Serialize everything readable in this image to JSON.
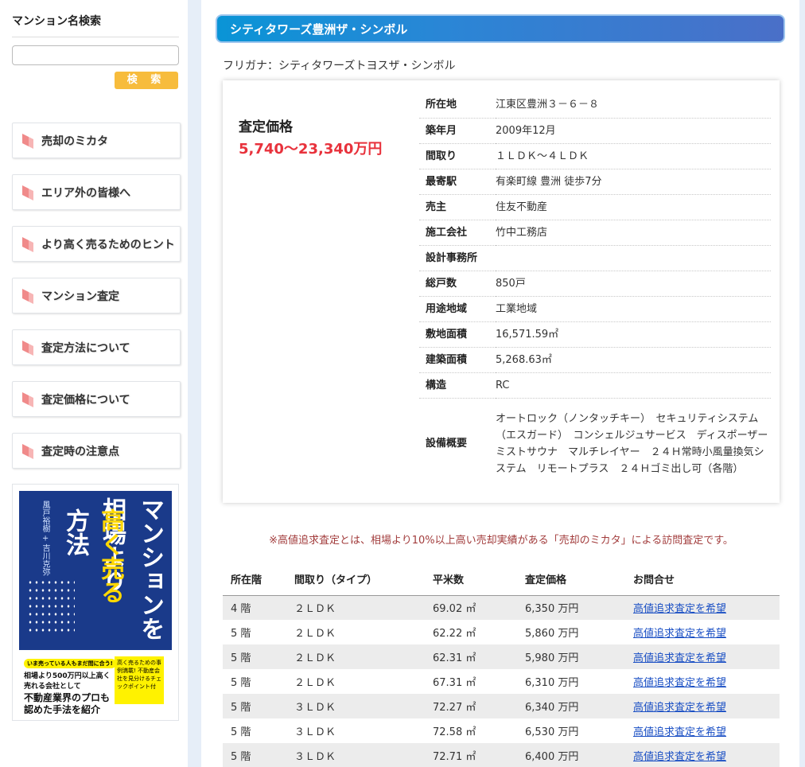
{
  "sidebar": {
    "search_title": "マンション名検索",
    "search_input_value": "",
    "search_button": "検 索",
    "menu": [
      {
        "label": "売却のミカタ"
      },
      {
        "label": "エリア外の皆様へ"
      },
      {
        "label": "より高く売るためのヒント"
      },
      {
        "label": "マンション査定"
      },
      {
        "label": "査定方法について"
      },
      {
        "label": "査定価格について"
      },
      {
        "label": "査定時の注意点"
      }
    ],
    "icon_color": "#f08a8a",
    "book": {
      "title_line1": "マンションを",
      "title_line2": "相場より",
      "title_line3": "高く売る",
      "title_line4": "方法",
      "authors": "風戸裕樹 + 吉川克弥",
      "badge": "いま売っている人もまだ間に合う!",
      "sub1": "相場より500万円以上高く売れる会社として",
      "sub2": "不動産業界のプロも認めた手法を紹介",
      "yellow_box": "高く売るための事例満載! 不動産会社を見分けるチェックポイント付"
    }
  },
  "main": {
    "title": "シティタワーズ豊洲ザ・シンボル",
    "furigana": "フリガナ：シティタワーズトヨスザ・シンボル",
    "price_label": "査定価格",
    "price_value": "5,740～23,340万円",
    "specs": [
      {
        "key": "所在地",
        "value": "江東区豊洲３－６－８"
      },
      {
        "key": "築年月",
        "value": "2009年12月"
      },
      {
        "key": "間取り",
        "value": "１ＬＤＫ～４ＬＤＫ"
      },
      {
        "key": "最寄駅",
        "value": "有楽町線 豊洲 徒歩7分"
      },
      {
        "key": "売主",
        "value": "住友不動産"
      },
      {
        "key": "施工会社",
        "value": "竹中工務店"
      },
      {
        "key": "設計事務所",
        "value": ""
      },
      {
        "key": "総戸数",
        "value": "850戸"
      },
      {
        "key": "用途地域",
        "value": "工業地域"
      },
      {
        "key": "敷地面積",
        "value": "16,571.59㎡"
      },
      {
        "key": "建築面積",
        "value": "5,268.63㎡"
      },
      {
        "key": "構造",
        "value": "RC"
      },
      {
        "key": "設備概要",
        "value": "オートロック（ノンタッチキー）　セキュリティシステム（エスガード）　コンシェルジュサービス　ディスポーザー　ミストサウナ　マルチレイヤー　２４Ｈ常時小風量換気システム　リモートプラス　２４Ｈゴミ出し可（各階）"
      }
    ],
    "notice": "※高値追求査定とは、相場より10%以上高い売却実績がある「売却のミカタ」による訪問査定です。",
    "units_headers": [
      "所在階",
      "間取り（タイプ）",
      "平米数",
      "査定価格",
      "お問合せ"
    ],
    "units": [
      {
        "floor": "4 階",
        "layout": "２ＬＤＫ",
        "area": "69.02 ㎡",
        "price": "6,350 万円",
        "link": "高値追求査定を希望"
      },
      {
        "floor": "5 階",
        "layout": "２ＬＤＫ",
        "area": "62.22 ㎡",
        "price": "5,860 万円",
        "link": "高値追求査定を希望"
      },
      {
        "floor": "5 階",
        "layout": "２ＬＤＫ",
        "area": "62.31 ㎡",
        "price": "5,980 万円",
        "link": "高値追求査定を希望"
      },
      {
        "floor": "5 階",
        "layout": "２ＬＤＫ",
        "area": "67.31 ㎡",
        "price": "6,310 万円",
        "link": "高値追求査定を希望"
      },
      {
        "floor": "5 階",
        "layout": "３ＬＤＫ",
        "area": "72.27 ㎡",
        "price": "6,340 万円",
        "link": "高値追求査定を希望"
      },
      {
        "floor": "5 階",
        "layout": "３ＬＤＫ",
        "area": "72.58 ㎡",
        "price": "6,530 万円",
        "link": "高値追求査定を希望"
      },
      {
        "floor": "5 階",
        "layout": "３ＬＤＫ",
        "area": "72.71 ㎡",
        "price": "6,400 万円",
        "link": "高値追求査定を希望"
      }
    ]
  }
}
